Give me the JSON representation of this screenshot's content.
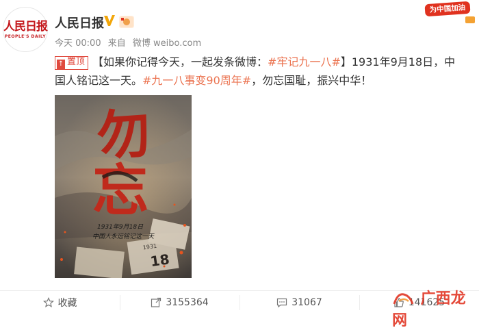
{
  "account": {
    "name": "人民日报",
    "logo_cn": "人民日报",
    "logo_en": "PEOPLE'S DAILY",
    "verified_icon": "verified-v-icon",
    "fan_badge_icon": "fan-badge-icon"
  },
  "meta": {
    "time": "今天 00:00",
    "source_prefix": "来自",
    "source": "微博 weibo.com"
  },
  "promo": {
    "label": "为中国加油"
  },
  "post": {
    "pin_label": "置顶",
    "text_open": "【如果你记得今天，一起发条微博：",
    "tag1": "#牢记九一八#",
    "text_mid": "】1931年9月18日，中国人铭记这一天。",
    "tag2": "#九一八事变90周年#",
    "text_end": "，勿忘国耻，振兴中华！"
  },
  "poster": {
    "char1": "勿",
    "char2": "忘",
    "date": "1931年9月18日",
    "line": "中国人永远铭记这一天",
    "num": "18",
    "year": "1931"
  },
  "footer": {
    "favorite_label": "收藏",
    "repost_count": "3155364",
    "comment_count": "31067",
    "like_count": "141625"
  },
  "watermark": {
    "text": "广西龙网"
  },
  "colors": {
    "accent": "#eb7350",
    "brand_red": "#c4171b",
    "pin_red": "#e04a3e"
  }
}
